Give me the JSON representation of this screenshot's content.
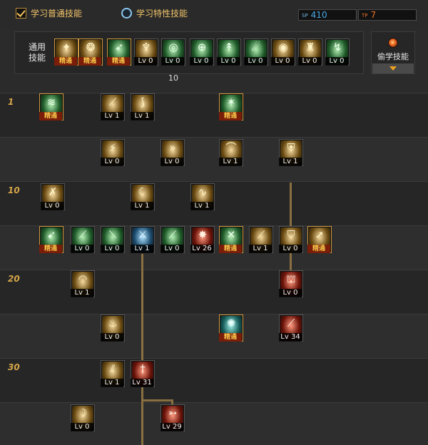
{
  "modes": {
    "normal_label": "学习普通技能",
    "trait_label": "学习特性技能"
  },
  "points": {
    "sp_tag": "SP",
    "sp_value": "410",
    "tp_tag": "TP",
    "tp_value": "7"
  },
  "common": {
    "label": "通用技能",
    "unlock_level": "10",
    "skills": [
      {
        "lvl": "精通",
        "icon": "spin-attack-icon",
        "glyph": "✦",
        "tone": "gold",
        "mastered": true
      },
      {
        "lvl": "精通",
        "icon": "whirl-strike-icon",
        "glyph": "❂",
        "tone": "gold",
        "mastered": true
      },
      {
        "lvl": "精通",
        "icon": "dash-run-icon",
        "glyph": "➶",
        "tone": "green",
        "mastered": true
      },
      {
        "lvl": "Lv 0",
        "icon": "wings-icon",
        "glyph": "♆",
        "tone": "gold",
        "mastered": false
      },
      {
        "lvl": "Lv 0",
        "icon": "target-aura-icon",
        "glyph": "◎",
        "tone": "green",
        "mastered": false
      },
      {
        "lvl": "Lv 0",
        "icon": "crosshair-icon",
        "glyph": "⊕",
        "tone": "green",
        "mastered": false
      },
      {
        "lvl": "Lv 0",
        "icon": "leap-icon",
        "glyph": "↟",
        "tone": "green",
        "mastered": false
      },
      {
        "lvl": "Lv 0",
        "icon": "throw-icon",
        "glyph": "☄",
        "tone": "green",
        "mastered": false
      },
      {
        "lvl": "Lv 0",
        "icon": "ring-icon",
        "glyph": "◉",
        "tone": "gold",
        "mastered": false
      },
      {
        "lvl": "Lv 0",
        "icon": "power-up-icon",
        "glyph": "♜",
        "tone": "gold",
        "mastered": false
      },
      {
        "lvl": "Lv 0",
        "icon": "kick-icon",
        "glyph": "↯",
        "tone": "green",
        "mastered": false
      }
    ]
  },
  "steal": {
    "label": "偷学技能"
  },
  "tree": {
    "levels": [
      "1",
      "",
      "10",
      "",
      "20",
      "",
      "30",
      ""
    ],
    "skills": [
      {
        "lvl": "精通",
        "icon": "slash-flurry-icon",
        "glyph": "≋",
        "tone": "green",
        "mastered": true
      },
      {
        "lvl": "Lv 1",
        "icon": "blade-slash-icon",
        "glyph": "⟋",
        "tone": "gold",
        "mastered": false
      },
      {
        "lvl": "Lv 1",
        "icon": "upper-slash-icon",
        "glyph": "⟆",
        "tone": "gold",
        "mastered": false
      },
      {
        "lvl": "精通",
        "icon": "burst-kick-icon",
        "glyph": "✶",
        "tone": "green",
        "mastered": true
      },
      {
        "lvl": "Lv 0",
        "icon": "claw-strike-icon",
        "glyph": "⚡",
        "tone": "gold",
        "mastered": false
      },
      {
        "lvl": "Lv 0",
        "icon": "triple-arrow-icon",
        "glyph": "»",
        "tone": "gold",
        "mastered": false
      },
      {
        "lvl": "Lv 1",
        "icon": "fan-slash-icon",
        "glyph": "⌒",
        "tone": "gold",
        "mastered": false
      },
      {
        "lvl": "Lv 1",
        "icon": "shield-icon",
        "glyph": "⛨",
        "tone": "gold",
        "mastered": false
      },
      {
        "lvl": "Lv 0",
        "icon": "cross-cut-icon",
        "glyph": "✗",
        "tone": "gold",
        "mastered": false
      },
      {
        "lvl": "Lv 1",
        "icon": "moon-swirl-icon",
        "glyph": "☾",
        "tone": "gold",
        "mastered": false
      },
      {
        "lvl": "Lv 1",
        "icon": "rising-wave-icon",
        "glyph": "∿",
        "tone": "gold",
        "mastered": false
      },
      {
        "lvl": "精通",
        "icon": "lunge-icon",
        "glyph": "➹",
        "tone": "green",
        "mastered": true
      },
      {
        "lvl": "Lv 0",
        "icon": "green-blade-icon",
        "glyph": "⟋",
        "tone": "green",
        "mastered": false
      },
      {
        "lvl": "Lv 0",
        "icon": "green-sword-icon",
        "glyph": "⟍",
        "tone": "green",
        "mastered": false
      },
      {
        "lvl": "Lv 1",
        "icon": "dual-blade-icon",
        "glyph": "⚔",
        "tone": "blue",
        "mastered": false
      },
      {
        "lvl": "Lv 0",
        "icon": "katana-icon",
        "glyph": "⟋",
        "tone": "green",
        "mastered": false
      },
      {
        "lvl": "Lv 26",
        "icon": "explosion-icon",
        "glyph": "✸",
        "tone": "red",
        "mastered": false
      },
      {
        "lvl": "精通",
        "icon": "crossed-blades-icon",
        "glyph": "✕",
        "tone": "green",
        "mastered": true
      },
      {
        "lvl": "Lv 1",
        "icon": "crescent-slash-icon",
        "glyph": "⟋",
        "tone": "gold",
        "mastered": false
      },
      {
        "lvl": "Lv 0",
        "icon": "guard-break-icon",
        "glyph": "⛉",
        "tone": "gold",
        "mastered": false
      },
      {
        "lvl": "精通",
        "icon": "spear-thrust-icon",
        "glyph": "➚",
        "tone": "gold",
        "mastered": true
      },
      {
        "lvl": "Lv 1",
        "icon": "arc-cut-icon",
        "glyph": "◠",
        "tone": "gold",
        "mastered": false
      },
      {
        "lvl": "Lv 0",
        "icon": "fortress-icon",
        "glyph": "⛫",
        "tone": "red",
        "mastered": false
      },
      {
        "lvl": "Lv 0",
        "icon": "flame-arc-icon",
        "glyph": "♨",
        "tone": "gold",
        "mastered": false
      },
      {
        "lvl": "精通",
        "icon": "shockwave-icon",
        "glyph": "✺",
        "tone": "teal",
        "mastered": true
      },
      {
        "lvl": "Lv 34",
        "icon": "blood-slash-icon",
        "glyph": "⟋",
        "tone": "red",
        "mastered": false
      },
      {
        "lvl": "Lv 1",
        "icon": "storm-blades-icon",
        "glyph": "⫽",
        "tone": "gold",
        "mastered": false
      },
      {
        "lvl": "Lv 31",
        "icon": "sword-aura-icon",
        "glyph": "†",
        "tone": "red",
        "mastered": false
      },
      {
        "lvl": "Lv 0",
        "icon": "crescent-moon-icon",
        "glyph": "☽",
        "tone": "gold",
        "mastered": false
      },
      {
        "lvl": "Lv 29",
        "icon": "fire-dash-icon",
        "glyph": "➳",
        "tone": "red",
        "mastered": false
      }
    ]
  }
}
